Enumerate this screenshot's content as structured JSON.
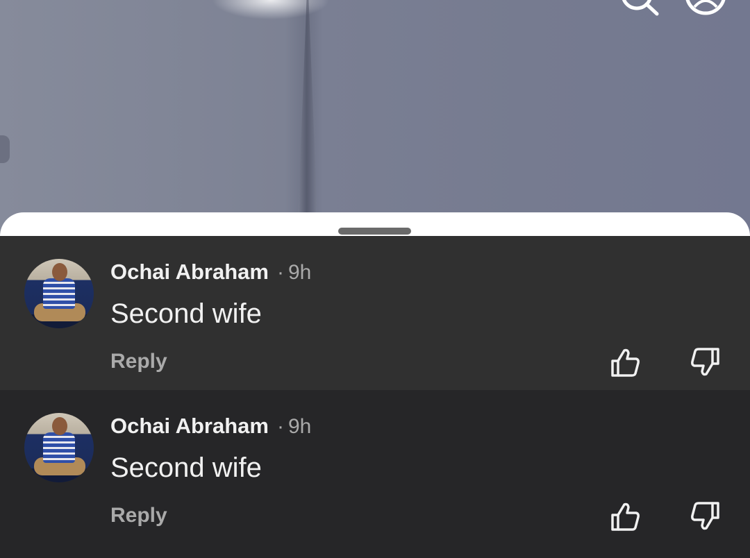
{
  "header": {
    "search_icon": "search-icon",
    "account_icon": "account-icon"
  },
  "comments": [
    {
      "author": "Ochai Abraham",
      "separator": "·",
      "time": "9h",
      "text": "Second wife",
      "reply_label": "Reply"
    },
    {
      "author": "Ochai Abraham",
      "separator": "·",
      "time": "9h",
      "text": "Second wife",
      "reply_label": "Reply"
    }
  ],
  "colors": {
    "sheet_header": "#ffffff",
    "comment_highlight_bg": "#303030",
    "comment_bg": "#262628",
    "primary_text": "#f1f1f1",
    "secondary_text": "#aaaaaa"
  }
}
